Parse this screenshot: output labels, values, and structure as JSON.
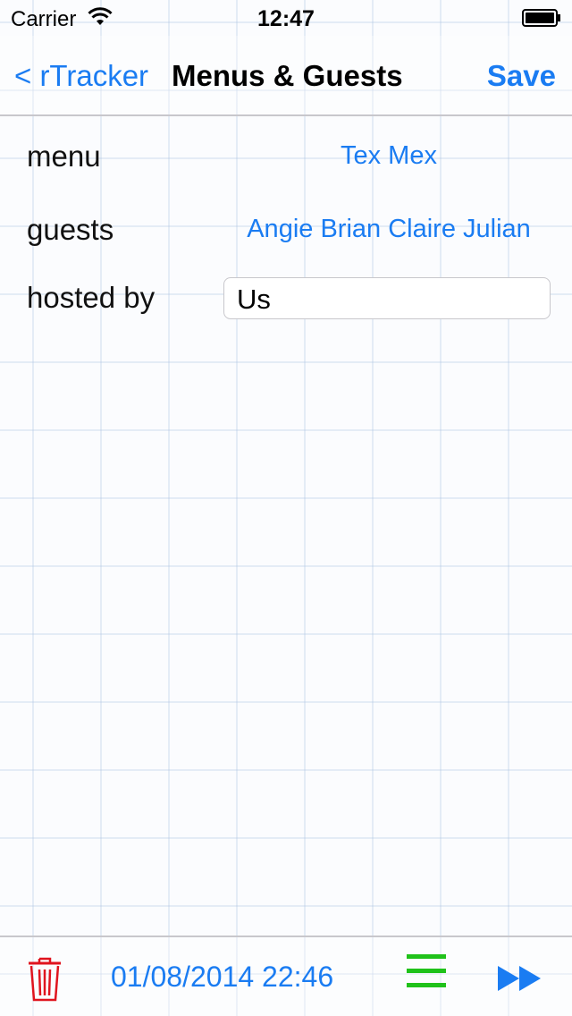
{
  "status_bar": {
    "carrier": "Carrier",
    "time": "12:47"
  },
  "nav": {
    "back_label": "< rTracker",
    "title": "Menus & Guests",
    "save_label": "Save"
  },
  "fields": [
    {
      "label": "menu",
      "value": "Tex Mex"
    },
    {
      "label": "guests",
      "value": "Angie Brian Claire Julian"
    },
    {
      "label": "hosted by",
      "value": "Us"
    }
  ],
  "toolbar": {
    "date": "01/08/2014 22:46",
    "icons": [
      "trash-icon",
      "list-icon",
      "fast-forward-icon"
    ]
  },
  "colors": {
    "accent": "#1a7cf2",
    "trash": "#e0141e",
    "list": "#20c21a"
  }
}
